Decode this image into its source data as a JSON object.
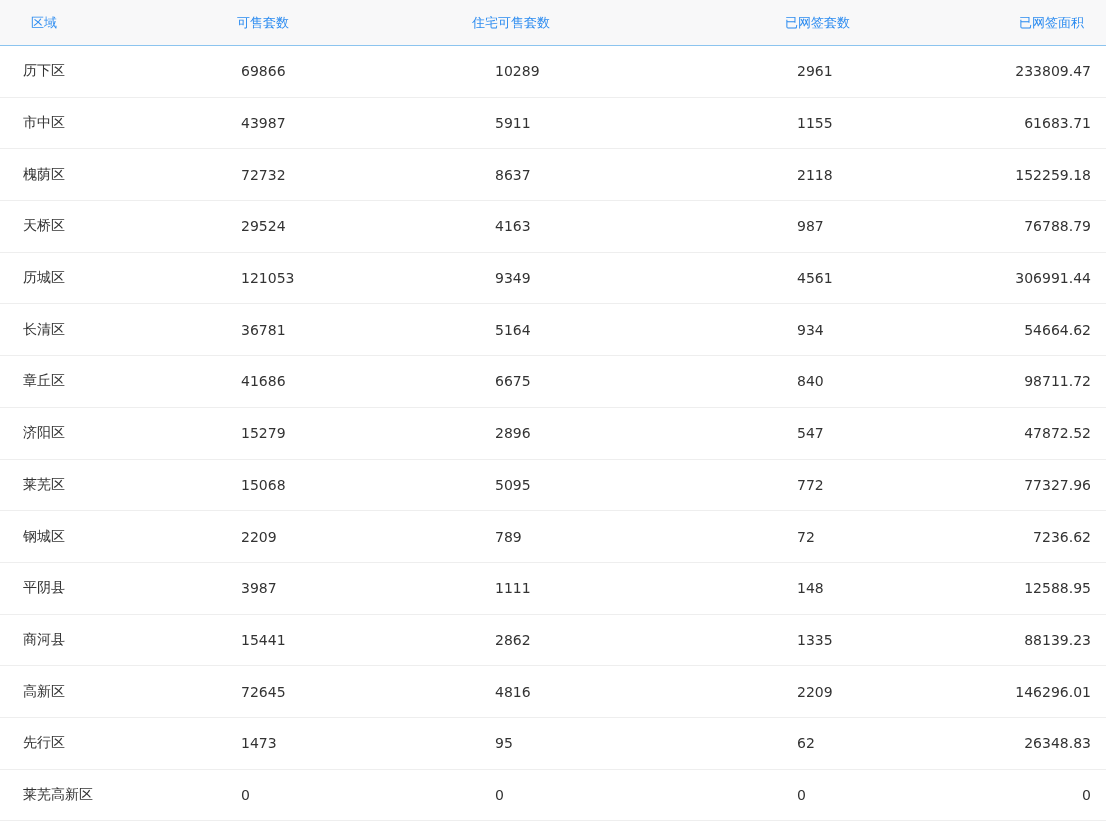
{
  "table": {
    "columns": [
      "区域",
      "可售套数",
      "住宅可售套数",
      "已网签套数",
      "已网签面积"
    ],
    "rows": [
      [
        "历下区",
        "69866",
        "10289",
        "2961",
        "233809.47"
      ],
      [
        "市中区",
        "43987",
        "5911",
        "1155",
        "61683.71"
      ],
      [
        "槐荫区",
        "72732",
        "8637",
        "2118",
        "152259.18"
      ],
      [
        "天桥区",
        "29524",
        "4163",
        "987",
        "76788.79"
      ],
      [
        "历城区",
        "121053",
        "9349",
        "4561",
        "306991.44"
      ],
      [
        "长清区",
        "36781",
        "5164",
        "934",
        "54664.62"
      ],
      [
        "章丘区",
        "41686",
        "6675",
        "840",
        "98711.72"
      ],
      [
        "济阳区",
        "15279",
        "2896",
        "547",
        "47872.52"
      ],
      [
        "莱芜区",
        "15068",
        "5095",
        "772",
        "77327.96"
      ],
      [
        "钢城区",
        "2209",
        "789",
        "72",
        "7236.62"
      ],
      [
        "平阴县",
        "3987",
        "1111",
        "148",
        "12588.95"
      ],
      [
        "商河县",
        "15441",
        "2862",
        "1335",
        "88139.23"
      ],
      [
        "高新区",
        "72645",
        "4816",
        "2209",
        "146296.01"
      ],
      [
        "先行区",
        "1473",
        "95",
        "62",
        "26348.83"
      ],
      [
        "莱芜高新区",
        "0",
        "0",
        "0",
        "0"
      ]
    ]
  }
}
